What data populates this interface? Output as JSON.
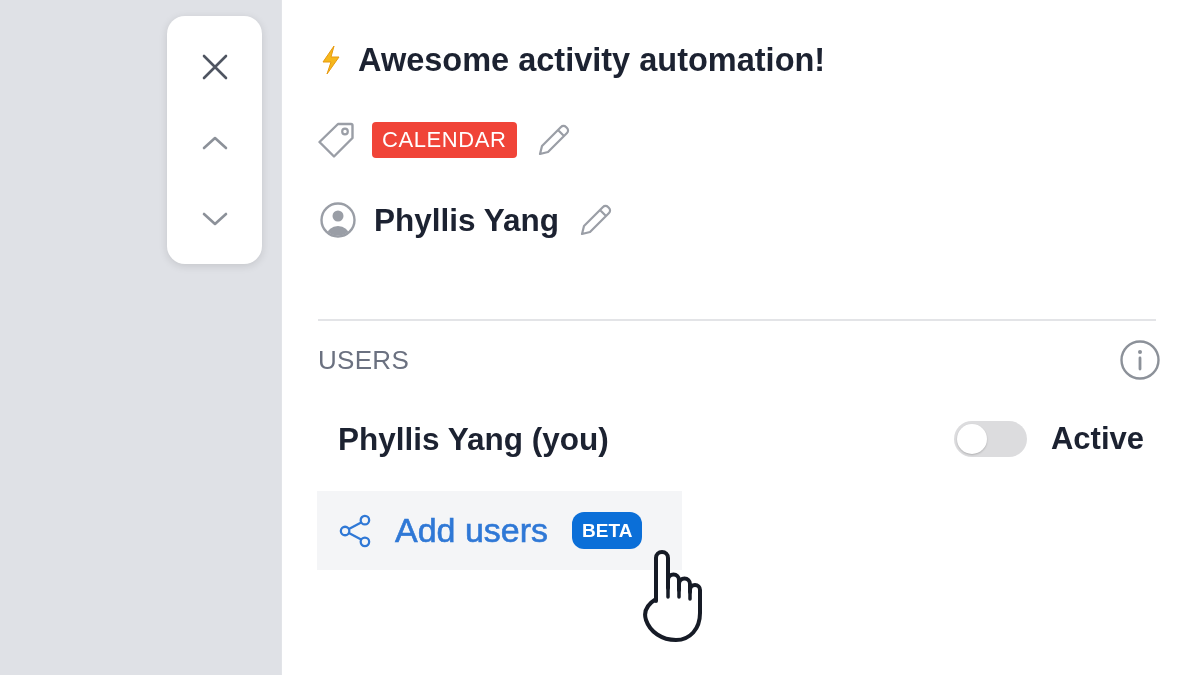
{
  "activity": {
    "title": "Awesome activity automation!",
    "tag": {
      "label": "CALENDAR"
    },
    "owner": "Phyllis Yang"
  },
  "users_section": {
    "heading": "USERS",
    "users": [
      {
        "name": "Phyllis Yang (you)",
        "on": false,
        "status": "Active"
      }
    ],
    "add_action": {
      "label": "Add users",
      "badge": "BETA"
    }
  }
}
